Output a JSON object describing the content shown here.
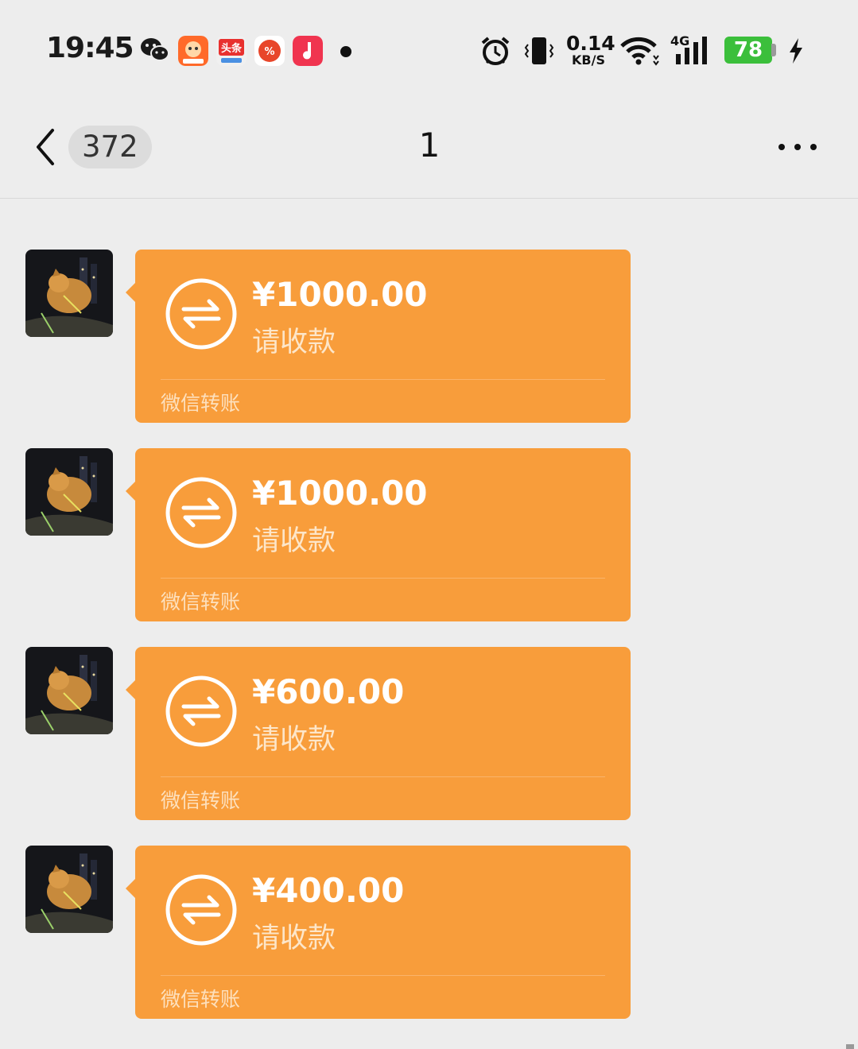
{
  "status_bar": {
    "time": "19:45",
    "network_speed_value": "0.14",
    "network_speed_unit": "KB/S",
    "network_type": "4G",
    "battery_level": "78",
    "app_icons": [
      "wechat-icon",
      "taobao-icon",
      "toutiao-icon",
      "app-icon",
      "music-icon"
    ]
  },
  "nav": {
    "unread_count": "372",
    "title": "1"
  },
  "messages": [
    {
      "amount": "¥1000.00",
      "status": "请收款",
      "footer": "微信转账"
    },
    {
      "amount": "¥1000.00",
      "status": "请收款",
      "footer": "微信转账"
    },
    {
      "amount": "¥600.00",
      "status": "请收款",
      "footer": "微信转账"
    },
    {
      "amount": "¥400.00",
      "status": "请收款",
      "footer": "微信转账"
    }
  ],
  "colors": {
    "bubble": "#f89d3b",
    "background": "#ededed",
    "battery": "#3bbf3b"
  }
}
